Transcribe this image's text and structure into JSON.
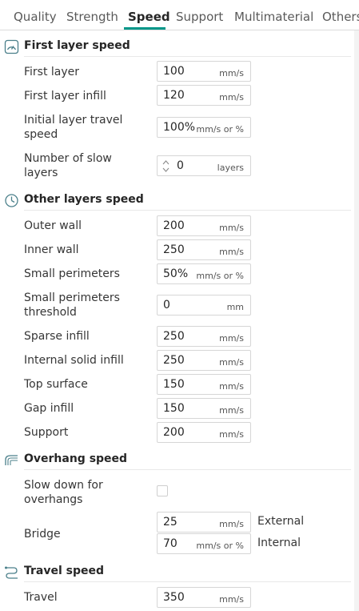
{
  "tabs": [
    "Quality",
    "Strength",
    "Speed",
    "Support",
    "Multimaterial",
    "Others"
  ],
  "sections": {
    "first_layer": "First layer speed",
    "other_layers": "Other layers speed",
    "overhang": "Overhang speed",
    "travel": "Travel speed"
  },
  "first_layer": {
    "first_layer": {
      "label": "First layer",
      "value": "100",
      "unit": "mm/s"
    },
    "first_layer_infill": {
      "label": "First layer infill",
      "value": "120",
      "unit": "mm/s"
    },
    "initial_travel": {
      "label_line1": "Initial layer travel",
      "label_line2": "speed",
      "value": "100%",
      "unit": "mm/s or %"
    },
    "slow_layers": {
      "label_line1": "Number of slow",
      "label_line2": "layers",
      "value": "0",
      "unit": "layers"
    }
  },
  "other_layers": {
    "outer_wall": {
      "label": "Outer wall",
      "value": "200",
      "unit": "mm/s"
    },
    "inner_wall": {
      "label": "Inner wall",
      "value": "250",
      "unit": "mm/s"
    },
    "small_perimeters": {
      "label": "Small perimeters",
      "value": "50%",
      "unit": "mm/s or %"
    },
    "small_perimeters_threshold": {
      "label_line1": "Small perimeters",
      "label_line2": "threshold",
      "value": "0",
      "unit": "mm"
    },
    "sparse_infill": {
      "label": "Sparse infill",
      "value": "250",
      "unit": "mm/s"
    },
    "internal_solid_infill": {
      "label": "Internal solid infill",
      "value": "250",
      "unit": "mm/s"
    },
    "top_surface": {
      "label": "Top surface",
      "value": "150",
      "unit": "mm/s"
    },
    "gap_infill": {
      "label": "Gap infill",
      "value": "150",
      "unit": "mm/s"
    },
    "support": {
      "label": "Support",
      "value": "200",
      "unit": "mm/s"
    }
  },
  "overhang": {
    "slow_down": {
      "label_line1": "Slow down for",
      "label_line2": "overhangs",
      "checked": false
    },
    "bridge": {
      "label": "Bridge",
      "external": {
        "value": "25",
        "unit": "mm/s",
        "side_label": "External"
      },
      "internal": {
        "value": "70",
        "unit": "mm/s or %",
        "side_label": "Internal"
      }
    }
  },
  "travel": {
    "travel": {
      "label": "Travel",
      "value": "350",
      "unit": "mm/s"
    }
  },
  "colors": {
    "accent": "#009688",
    "border": "#d6d6d6",
    "text": "#363636"
  }
}
